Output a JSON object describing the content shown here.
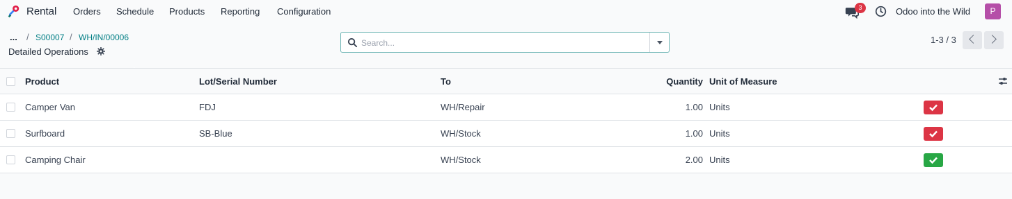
{
  "topbar": {
    "app_name": "Rental",
    "menus": [
      "Orders",
      "Schedule",
      "Products",
      "Reporting",
      "Configuration"
    ],
    "chat_badge": "3",
    "company": "Odoo into the Wild",
    "avatar_initial": "P"
  },
  "breadcrumb": {
    "more": "...",
    "separator": "/",
    "items": [
      "S00007",
      "WH/IN/00006"
    ]
  },
  "page": {
    "title": "Detailed Operations"
  },
  "search": {
    "value": "",
    "placeholder": "Search..."
  },
  "pager": {
    "text": "1-3 / 3"
  },
  "table": {
    "headers": {
      "product": "Product",
      "lot": "Lot/Serial Number",
      "to": "To",
      "quantity": "Quantity",
      "uom": "Unit of Measure"
    },
    "rows": [
      {
        "product": "Camper Van",
        "lot": "FDJ",
        "to": "WH/Repair",
        "quantity": "1.00",
        "uom": "Units",
        "status": "red"
      },
      {
        "product": "Surfboard",
        "lot": "SB-Blue",
        "to": "WH/Stock",
        "quantity": "1.00",
        "uom": "Units",
        "status": "red"
      },
      {
        "product": "Camping Chair",
        "lot": "",
        "to": "WH/Stock",
        "quantity": "2.00",
        "uom": "Units",
        "status": "green"
      }
    ]
  },
  "colors": {
    "brand": "#017e84",
    "red": "#dc3545",
    "green": "#28a745",
    "avatar": "#b54fa8"
  },
  "icons": [
    "app-key-icon",
    "chat-icon",
    "clock-icon",
    "gear-icon",
    "search-icon",
    "chevron-left-icon",
    "chevron-right-icon",
    "checkmark-icon",
    "column-settings-icon"
  ]
}
